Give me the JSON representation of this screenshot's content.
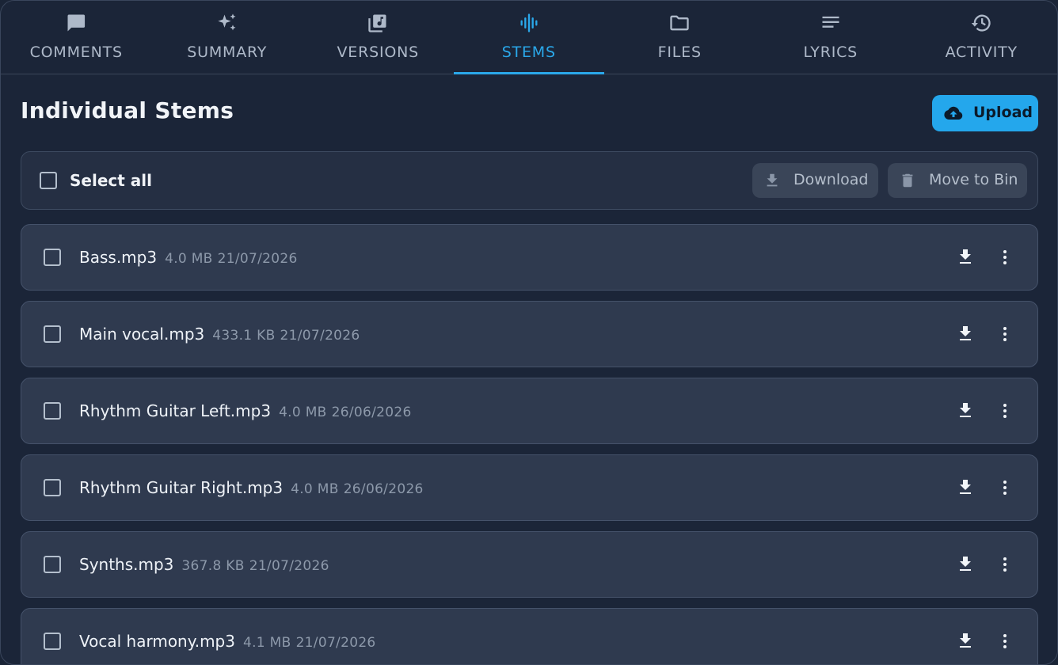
{
  "tabs": [
    {
      "label": "COMMENTS",
      "icon": "comment-icon",
      "active": false
    },
    {
      "label": "SUMMARY",
      "icon": "sparkle-icon",
      "active": false
    },
    {
      "label": "VERSIONS",
      "icon": "library-music-icon",
      "active": false
    },
    {
      "label": "STEMS",
      "icon": "waveform-icon",
      "active": true
    },
    {
      "label": "FILES",
      "icon": "folder-icon",
      "active": false
    },
    {
      "label": "LYRICS",
      "icon": "lines-icon",
      "active": false
    },
    {
      "label": "ACTIVITY",
      "icon": "history-icon",
      "active": false
    }
  ],
  "page": {
    "title": "Individual Stems",
    "upload_label": "Upload"
  },
  "toolbar": {
    "select_all_label": "Select all",
    "download_label": "Download",
    "move_to_bin_label": "Move to Bin"
  },
  "stems": [
    {
      "name": "Bass.mp3",
      "size": "4.0 MB",
      "date": "21/07/2026"
    },
    {
      "name": "Main vocal.mp3",
      "size": "433.1 KB",
      "date": "21/07/2026"
    },
    {
      "name": "Rhythm Guitar Left.mp3",
      "size": "4.0 MB",
      "date": "26/06/2026"
    },
    {
      "name": "Rhythm Guitar Right.mp3",
      "size": "4.0 MB",
      "date": "26/06/2026"
    },
    {
      "name": "Synths.mp3",
      "size": "367.8 KB",
      "date": "21/07/2026"
    },
    {
      "name": "Vocal harmony.mp3",
      "size": "4.1 MB",
      "date": "21/07/2026"
    }
  ],
  "colors": {
    "accent": "#2aa8ea",
    "background": "#1b2538",
    "row_background": "#2f3a4f"
  }
}
